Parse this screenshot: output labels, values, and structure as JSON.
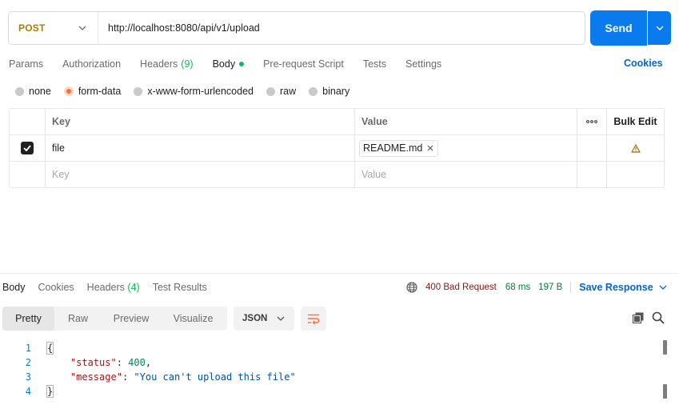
{
  "request": {
    "method": "POST",
    "url": "http://localhost:8080/api/v1/upload",
    "send_label": "Send"
  },
  "request_tabs": [
    {
      "label": "Params"
    },
    {
      "label": "Authorization"
    },
    {
      "label": "Headers",
      "count": "(9)"
    },
    {
      "label": "Body",
      "active": true
    },
    {
      "label": "Pre-request Script"
    },
    {
      "label": "Tests"
    },
    {
      "label": "Settings"
    }
  ],
  "cookies_label": "Cookies",
  "body_types": [
    {
      "label": "none"
    },
    {
      "label": "form-data",
      "selected": true
    },
    {
      "label": "x-www-form-urlencoded"
    },
    {
      "label": "raw"
    },
    {
      "label": "binary"
    }
  ],
  "form_table": {
    "headers": {
      "key": "Key",
      "value": "Value",
      "bulk_edit": "Bulk Edit"
    },
    "rows": [
      {
        "checked": true,
        "key": "file",
        "value": "README.md"
      }
    ],
    "empty_row": {
      "key_placeholder": "Key",
      "value_placeholder": "Value"
    }
  },
  "response": {
    "tabs": [
      {
        "label": "Body",
        "active": true
      },
      {
        "label": "Cookies"
      },
      {
        "label": "Headers",
        "count": "(4)"
      },
      {
        "label": "Test Results"
      }
    ],
    "status": "400 Bad Request",
    "time": "68 ms",
    "size": "197 B",
    "save_label": "Save Response",
    "view_modes": [
      "Pretty",
      "Raw",
      "Preview",
      "Visualize"
    ],
    "active_view": "Pretty",
    "format": "JSON",
    "code_lines": [
      {
        "num": "1"
      },
      {
        "num": "2",
        "key": "\"status\"",
        "value": "400"
      },
      {
        "num": "3",
        "key": "\"message\"",
        "value": "\"You can't upload this file\""
      },
      {
        "num": "4"
      }
    ]
  },
  "colors": {
    "accent": "#097bed",
    "method": "#ad7a03",
    "status_error": "#8e1a10",
    "ok_green": "#007f31",
    "radio_selected": "#ff6c37"
  }
}
